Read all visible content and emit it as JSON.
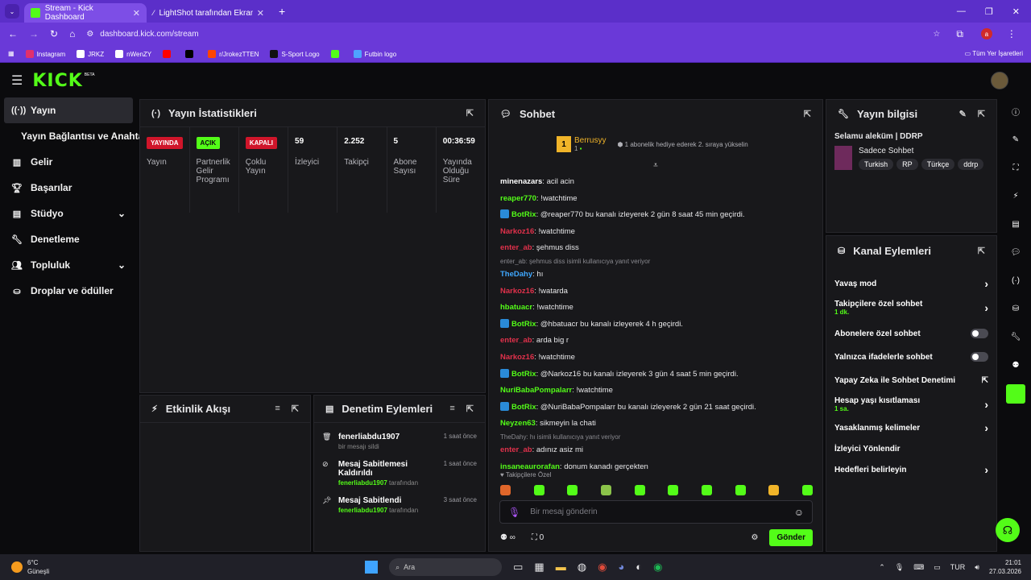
{
  "browser": {
    "tabs": [
      {
        "label": "Stream - Kick Dashboard",
        "active": true
      },
      {
        "label": "LightShot tarafından Ekran Gör...",
        "active": false
      }
    ],
    "url": "dashboard.kick.com/stream",
    "profile": "a",
    "bookmarks": [
      "Instagram",
      "JRKZ",
      "nWenZY",
      "r/JrokezTTEN",
      "S-Sport Logo",
      "Futbin logo"
    ],
    "all_bookmarks": "Tüm Yer İşaretleri"
  },
  "app": {
    "logo": "KICK",
    "beta": "BETA",
    "accent": "#53fc18"
  },
  "sidebar": {
    "items": [
      {
        "label": "Yayın",
        "icon": "broadcast-icon"
      },
      {
        "label": "Yayın Bağlantısı ve Anahtarı",
        "icon": ""
      },
      {
        "label": "Gelir",
        "icon": "chart-icon"
      },
      {
        "label": "Başarılar",
        "icon": "trophy-icon"
      },
      {
        "label": "Stüdyo",
        "icon": "studio-icon"
      },
      {
        "label": "Denetleme",
        "icon": "wrench-icon"
      },
      {
        "label": "Topluluk",
        "icon": "people-icon"
      },
      {
        "label": "Droplar ve ödüller",
        "icon": "drop-icon"
      }
    ]
  },
  "stats": {
    "title": "Yayın İstatistikleri",
    "cols": [
      {
        "badge": "YAYINDA",
        "label": "Yayın",
        "color": "#d0152a"
      },
      {
        "badge": "AÇIK",
        "label": "Partnerlik Gelir Programı",
        "color": "#53fc18"
      },
      {
        "badge": "KAPALI",
        "label": "Çoklu Yayın",
        "color": "#d0152a"
      },
      {
        "value": "59",
        "label": "İzleyici"
      },
      {
        "value": "2.252",
        "label": "Takipçi"
      },
      {
        "value": "5",
        "label": "Abone Sayısı"
      },
      {
        "value": "00:36:59",
        "label": "Yayında Olduğu Süre"
      }
    ]
  },
  "activity": {
    "title": "Etkinlik Akışı"
  },
  "moderation": {
    "title": "Denetim Eylemleri",
    "items": [
      {
        "title": "fenerliabdu1907",
        "sub": "bir mesajı sildi",
        "time": "1 saat önce"
      },
      {
        "title": "Mesaj Sabitlemesi Kaldırıldı",
        "sub": "fenerliabdu1907",
        "sub2": "tarafından",
        "time": "1 saat önce"
      },
      {
        "title": "Mesaj Sabitlendi",
        "sub": "fenerliabdu1907",
        "sub2": "tarafından",
        "time": "3 saat önce"
      }
    ]
  },
  "chat": {
    "title": "Sohbet",
    "gift_user": "Berrusyy",
    "gift_count": "1",
    "gift_text": "1 abonelik hediye ederek 2. sıraya yükselin",
    "messages": [
      {
        "user": "minenazars",
        "color": "#ffffff",
        "text": "acil acin"
      },
      {
        "user": "reaper770",
        "color": "#53fc18",
        "text": "!watchtime"
      },
      {
        "user": "BotRix",
        "color": "#53fc18",
        "text": "@reaper770 bu kanalı izleyerek 2 gün 8 saat 45 min geçirdi."
      },
      {
        "user": "Narkoz16",
        "color": "#e0314b",
        "text": "!watchtime"
      },
      {
        "user": "enter_ab",
        "color": "#e0314b",
        "text": "şehmus diss"
      },
      {
        "reply": "enter_ab: şehmus diss isimli kullanıcıya yanıt veriyor",
        "user": "TheDahy",
        "color": "#3fa8ff",
        "text": "hı"
      },
      {
        "user": "Narkoz16",
        "color": "#e0314b",
        "text": "!watarda"
      },
      {
        "user": "hbatuacr",
        "color": "#53fc18",
        "text": "!watchtime"
      },
      {
        "user": "BotRix",
        "color": "#53fc18",
        "text": "@hbatuacr bu kanalı izleyerek 4 h geçirdi."
      },
      {
        "user": "enter_ab",
        "color": "#e0314b",
        "text": "arda big r"
      },
      {
        "user": "Narkoz16",
        "color": "#e0314b",
        "text": "!watchtime"
      },
      {
        "user": "BotRix",
        "color": "#53fc18",
        "text": "@Narkoz16 bu kanalı izleyerek 3 gün 4 saat 5 min geçirdi."
      },
      {
        "user": "NuriBabaPompalarr",
        "color": "#53fc18",
        "text": "!watchtime"
      },
      {
        "user": "BotRix",
        "color": "#53fc18",
        "text": "@NuriBabaPompalarr bu kanalı izleyerek 2 gün 21 saat geçirdi."
      },
      {
        "user": "Neyzen63",
        "color": "#53fc18",
        "text": "sikmeyin la chati"
      },
      {
        "reply": "TheDahy: hı isimli kullanıcıya yanıt veriyor",
        "user": "enter_ab",
        "color": "#e0314b",
        "text": "adınız asiz mi"
      },
      {
        "user": "insaneaurorafan",
        "color": "#53fc18",
        "text": "donum kanadı gerçekten"
      }
    ],
    "followers_only": "Takipçilere Özel",
    "placeholder": "Bir mesaj gönderin",
    "infinity": "∞",
    "count": "0",
    "send": "Gönder"
  },
  "stream_info": {
    "title": "Yayın bilgisi",
    "stream_title": "Selamu aleküm | DDRP",
    "category": "Sadece Sohbet",
    "tags": [
      "Turkish",
      "RP",
      "Türkçe",
      "ddrp"
    ]
  },
  "channel_actions": {
    "title": "Kanal Eylemleri",
    "rows": [
      {
        "label": "Yavaş mod",
        "control": "chevron"
      },
      {
        "label": "Takipçilere özel sohbet",
        "sub": "1 dk.",
        "control": "chevron"
      },
      {
        "label": "Abonelere özel sohbet",
        "control": "toggle"
      },
      {
        "label": "Yalnızca ifadelerle sohbet",
        "control": "toggle"
      },
      {
        "label": "Yapay Zeka ile Sohbet Denetimi",
        "control": "external"
      },
      {
        "label": "Hesap yaşı kısıtlaması",
        "sub": "1 sa.",
        "control": "chevron"
      },
      {
        "label": "Yasaklanmış kelimeler",
        "control": "chevron"
      },
      {
        "label": "İzleyici Yönlendir",
        "control": "none"
      },
      {
        "label": "Hedefleri belirleyin",
        "control": "chevron"
      }
    ]
  },
  "taskbar": {
    "weather": "6°C",
    "weather_desc": "Güneşli",
    "search": "Ara",
    "lang": "TUR",
    "time": "21:01",
    "date": "27.03.2026"
  }
}
